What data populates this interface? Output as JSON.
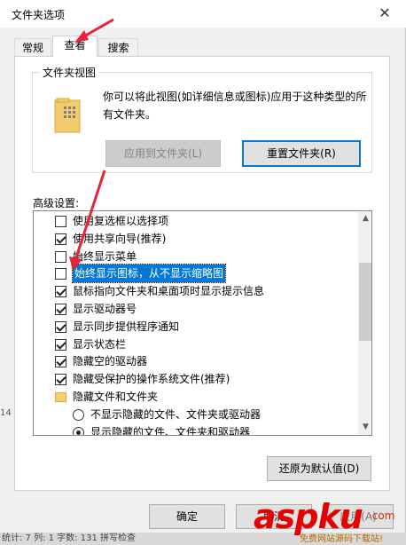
{
  "window": {
    "title": "文件夹选项",
    "close_glyph": "✕"
  },
  "tabs": [
    {
      "label": "常规",
      "active": false
    },
    {
      "label": "查看",
      "active": true
    },
    {
      "label": "搜索",
      "active": false
    }
  ],
  "folder_views": {
    "group_label": "文件夹视图",
    "description": "你可以将此视图(如详细信息或图标)应用于这种类型的所有文件夹。",
    "apply_button": "应用到文件夹(L)",
    "reset_button": "重置文件夹(R)"
  },
  "advanced": {
    "label": "高级设置:",
    "items": [
      {
        "type": "checkbox",
        "checked": false,
        "text": "使用复选框以选择项"
      },
      {
        "type": "checkbox",
        "checked": true,
        "text": "使用共享向导(推荐)"
      },
      {
        "type": "checkbox",
        "checked": false,
        "text": "始终显示菜单"
      },
      {
        "type": "checkbox",
        "checked": false,
        "text": "始终显示图标，从不显示缩略图",
        "selected": true
      },
      {
        "type": "checkbox",
        "checked": true,
        "text": "鼠标指向文件夹和桌面项时显示提示信息"
      },
      {
        "type": "checkbox",
        "checked": true,
        "text": "显示驱动器号"
      },
      {
        "type": "checkbox",
        "checked": true,
        "text": "显示同步提供程序通知"
      },
      {
        "type": "checkbox",
        "checked": true,
        "text": "显示状态栏"
      },
      {
        "type": "checkbox",
        "checked": true,
        "text": "隐藏空的驱动器"
      },
      {
        "type": "checkbox",
        "checked": true,
        "text": "隐藏受保护的操作系统文件(推荐)"
      },
      {
        "type": "folder",
        "text": "隐藏文件和文件夹"
      },
      {
        "type": "radio",
        "checked": false,
        "text": "不显示隐藏的文件、文件夹或驱动器"
      },
      {
        "type": "radio",
        "checked": true,
        "text": "显示隐藏的文件、文件夹和驱动器"
      }
    ],
    "restore_button": "还原为默认值(D)"
  },
  "footer": {
    "ok": "确定",
    "cancel": "取消",
    "apply": "应用(A)"
  },
  "statusbar": {
    "text": "统计: 7  列: 1  字数: 131  拼写检查"
  },
  "watermark": {
    "main": "aspku",
    "cn": "·com",
    "sub": "免费网站源码下载站!"
  },
  "edge_text": "14",
  "colors": {
    "selection": "#0078d7",
    "arrow": "#e8233a",
    "accent": "#0078d7"
  }
}
